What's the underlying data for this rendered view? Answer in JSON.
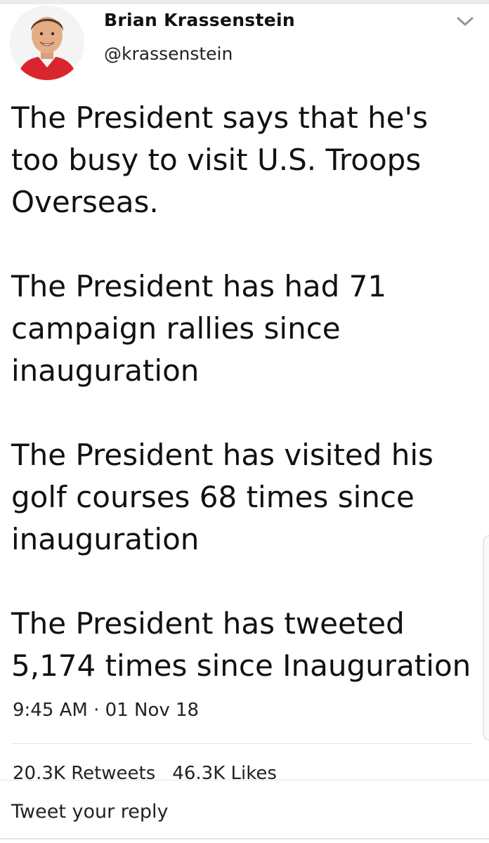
{
  "author": {
    "name": "Brian Krassenstein",
    "handle": "@krassenstein"
  },
  "icons": {
    "avatar": "profile-photo",
    "menu": "chevron-down-icon"
  },
  "tweet": {
    "paragraphs": [
      "The President says that he's too busy to visit U.S. Troops Overseas.",
      "The President has had 71 campaign rallies since inauguration",
      "The President has visited his golf courses 68 times since inauguration",
      "The President has tweeted 5,174 times since Inauguration"
    ],
    "timestamp": "9:45 AM · 01 Nov 18"
  },
  "stats": {
    "retweets": "20.3K Retweets",
    "likes": "46.3K Likes"
  },
  "reply": {
    "placeholder": "Tweet your reply"
  },
  "colors": {
    "background": "#ffffff",
    "text": "#111111",
    "divider": "#e1e8ed",
    "avatar_shirt": "#d9262e"
  }
}
